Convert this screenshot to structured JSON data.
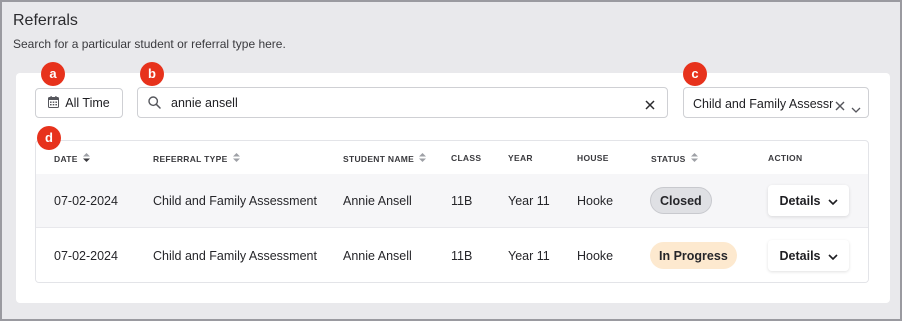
{
  "header": {
    "title": "Referrals",
    "subtitle": "Search for a particular student or referral type here."
  },
  "filters": {
    "date_button_label": "All Time",
    "search_value": "annie ansell",
    "referral_type_selected": "Child and Family Assessment"
  },
  "markers": [
    "a",
    "b",
    "c",
    "d"
  ],
  "table": {
    "columns": [
      "DATE",
      "REFERRAL TYPE",
      "STUDENT NAME",
      "CLASS",
      "YEAR",
      "HOUSE",
      "STATUS",
      "ACTION"
    ],
    "rows": [
      {
        "date": "07-02-2024",
        "referral_type": "Child and Family Assessment",
        "student_name": "Annie Ansell",
        "class": "11B",
        "year": "Year 11",
        "house": "Hooke",
        "status": "Closed",
        "action": "Details"
      },
      {
        "date": "07-02-2024",
        "referral_type": "Child and Family Assessment",
        "student_name": "Annie Ansell",
        "class": "11B",
        "year": "Year 11",
        "house": "Hooke",
        "status": "In Progress",
        "action": "Details"
      }
    ]
  },
  "colors": {
    "marker": "#e7321c",
    "status_closed_bg": "#dfe0e4",
    "status_in_progress_bg": "#fde9cf",
    "page_bg": "#e9e9ec"
  },
  "icons": {
    "date_button": "calendar-icon",
    "search": "search-icon",
    "clear": "close-icon",
    "dropdown": "chevron-down-icon",
    "sort": "sort-icon"
  }
}
